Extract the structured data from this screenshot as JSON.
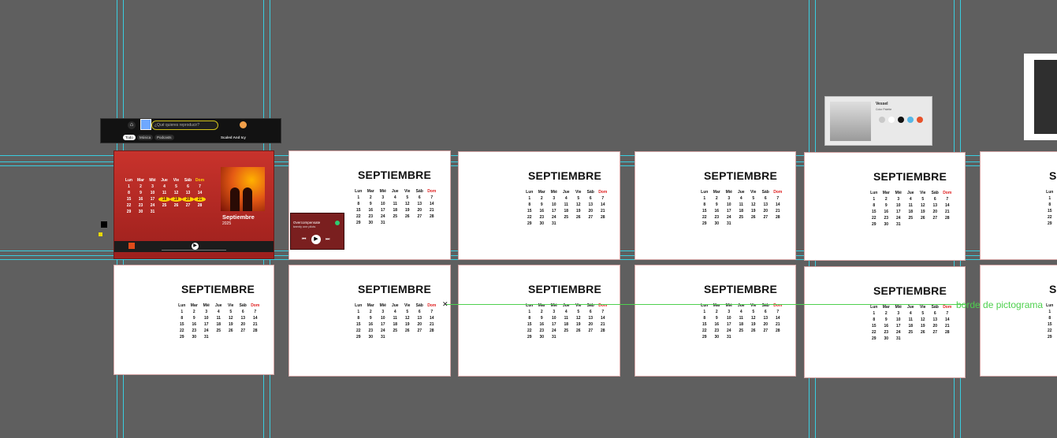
{
  "calendar": {
    "title": "SEPTIEMBRE",
    "weekdays": [
      "Lun",
      "Mar",
      "Mié",
      "Jue",
      "Vie",
      "Sáb",
      "Dom"
    ],
    "rows": [
      [
        "1",
        "2",
        "3",
        "4",
        "5",
        "6",
        "7"
      ],
      [
        "8",
        "9",
        "10",
        "11",
        "12",
        "13",
        "14"
      ],
      [
        "15",
        "16",
        "17",
        "18",
        "19",
        "20",
        "21"
      ],
      [
        "22",
        "23",
        "24",
        "25",
        "26",
        "27",
        "28"
      ],
      [
        "29",
        "30",
        "31",
        "",
        "",
        "",
        ""
      ]
    ]
  },
  "featured": {
    "month_label": "Septiembre",
    "year_label": "2025"
  },
  "player_top": {
    "search_placeholder": "¿Qué quieres reproducir?",
    "chips": [
      "Todo",
      "Música",
      "Podcasts"
    ],
    "right_label": "Scaled And Icy"
  },
  "mini_player": {
    "track": "Overcompensate",
    "artist": "twenty one pilots"
  },
  "swatch_card": {
    "title": "Vessel",
    "subtitle": "Color Palette",
    "colors": [
      "#c9c9c9",
      "#ffffff",
      "#111111",
      "#56b7e6",
      "#e8522a"
    ]
  },
  "annotation": {
    "text": "borde de pictograma"
  }
}
